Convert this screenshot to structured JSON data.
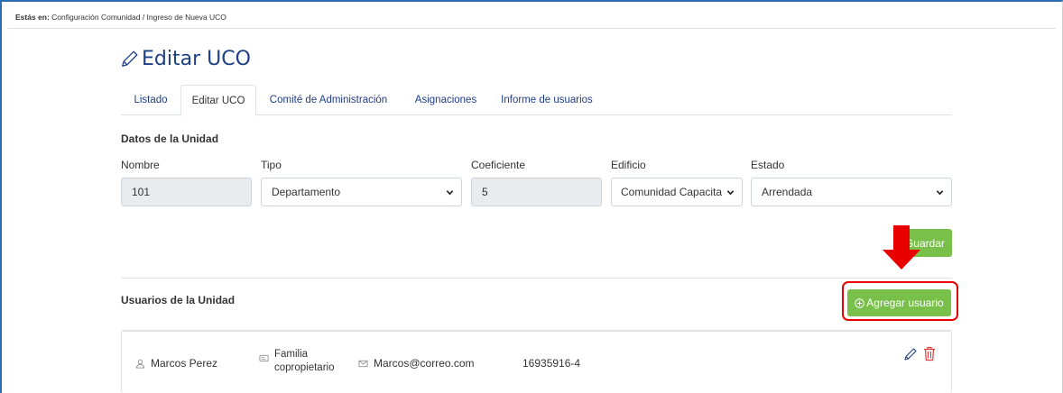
{
  "breadcrumb": {
    "lead": "Estás en:",
    "path": "Configuración Comunidad  /  Ingreso de Nueva UCO"
  },
  "page": {
    "title": "Editar UCO",
    "icon": "pencil-icon"
  },
  "tabs": [
    {
      "label": "Listado",
      "active": false
    },
    {
      "label": "Editar UCO",
      "active": true
    },
    {
      "label": "Comité de Administración",
      "active": false
    },
    {
      "label": "Asignaciones",
      "active": false
    },
    {
      "label": "Informe de usuarios",
      "active": false
    }
  ],
  "unit": {
    "section_title": "Datos de la Unidad",
    "fields": {
      "nombre": {
        "label": "Nombre",
        "value": "101"
      },
      "tipo": {
        "label": "Tipo",
        "value": "Departamento"
      },
      "coeficiente": {
        "label": "Coeficiente",
        "value": "5"
      },
      "edificio": {
        "label": "Edificio",
        "value": "Comunidad Capacita"
      },
      "estado": {
        "label": "Estado",
        "value": "Arrendada"
      }
    },
    "save_label": "Guardar"
  },
  "users": {
    "section_title": "Usuarios de la Unidad",
    "add_label": "Agregar usuario",
    "items": [
      {
        "name": "Marcos Perez",
        "role_line1": "Familia",
        "role_line2": "copropietario",
        "email": "Marcos@correo.com",
        "rut": "16935916-4"
      }
    ]
  },
  "colors": {
    "accent_green": "#79c04a",
    "title_blue": "#1d3f86",
    "link_blue": "#1f3c88",
    "highlight_red": "#e80000",
    "delete_red": "#e23b3b"
  }
}
